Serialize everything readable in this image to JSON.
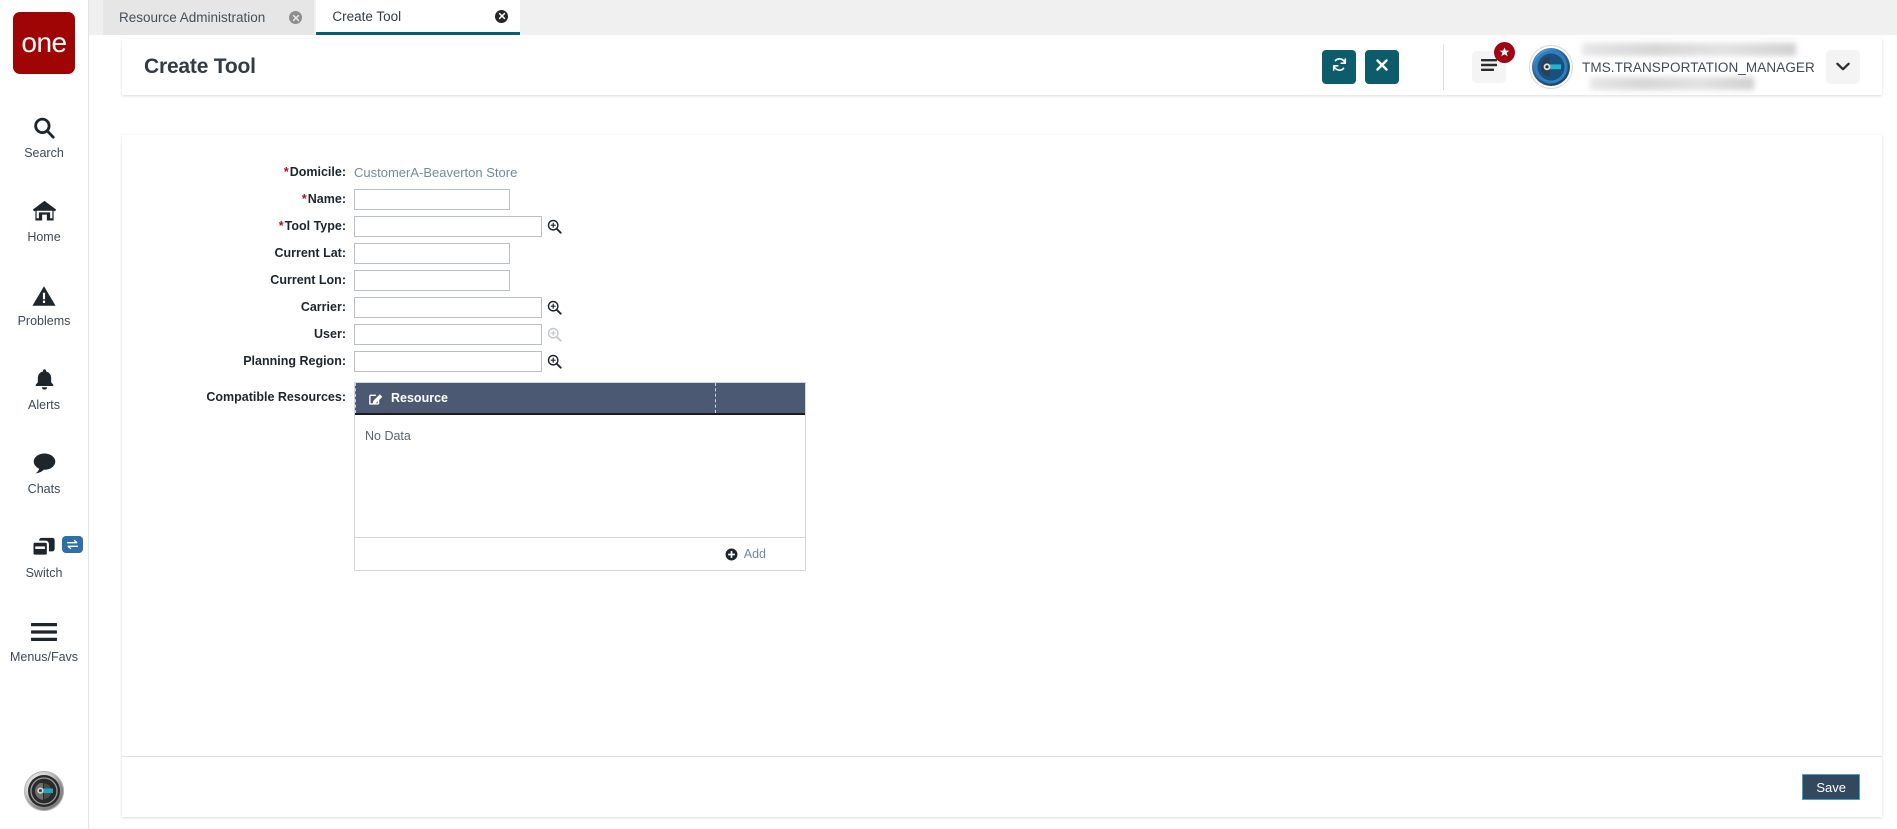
{
  "brand": {
    "logo_text": "one",
    "logo_color": "#a00505"
  },
  "sidebar": {
    "items": [
      {
        "label": "Search",
        "icon": "search-icon"
      },
      {
        "label": "Home",
        "icon": "home-icon"
      },
      {
        "label": "Problems",
        "icon": "warning-triangle-icon"
      },
      {
        "label": "Alerts",
        "icon": "bell-icon"
      },
      {
        "label": "Chats",
        "icon": "chat-bubble-icon"
      },
      {
        "label": "Switch",
        "icon": "windows-stack-icon",
        "badge_icon": "swap-arrows-icon"
      },
      {
        "label": "Menus/Favs",
        "icon": "hamburger-icon"
      }
    ],
    "bottom_avatar_icon": "ai-assistant-avatar"
  },
  "tabs": [
    {
      "label": "Resource Administration",
      "active": false,
      "close_icon": "close-circle-icon"
    },
    {
      "label": "Create Tool",
      "active": true,
      "close_icon": "close-circle-icon"
    }
  ],
  "header": {
    "title": "Create Tool",
    "refresh_icon": "refresh-icon",
    "close_icon": "close-x-icon",
    "menu_icon": "hamburger-menu-icon",
    "menu_badge_icon": "star-icon",
    "user_name": "TMS.TRANSPORTATION_MANAGER",
    "user_avatar_icon": "user-avatar",
    "caret_icon": "chevron-down-icon",
    "accent_color": "#0d5c6b",
    "badge_color": "#a00515"
  },
  "form": {
    "fields": [
      {
        "label": "Domicile",
        "required": true,
        "type": "link",
        "value": "CustomerA-Beaverton Store"
      },
      {
        "label": "Name",
        "required": true,
        "type": "text",
        "value": "",
        "width": "short"
      },
      {
        "label": "Tool Type",
        "required": true,
        "type": "lookup",
        "value": "",
        "width": "long",
        "lookup_enabled": true
      },
      {
        "label": "Current Lat",
        "required": false,
        "type": "text",
        "value": "",
        "width": "short"
      },
      {
        "label": "Current Lon",
        "required": false,
        "type": "text",
        "value": "",
        "width": "short"
      },
      {
        "label": "Carrier",
        "required": false,
        "type": "lookup",
        "value": "",
        "width": "long",
        "lookup_enabled": true
      },
      {
        "label": "User",
        "required": false,
        "type": "lookup",
        "value": "",
        "width": "long",
        "lookup_enabled": false
      },
      {
        "label": "Planning Region",
        "required": false,
        "type": "lookup",
        "value": "",
        "width": "long",
        "lookup_enabled": true
      }
    ],
    "resources_label": "Compatible Resources",
    "resources_required": false
  },
  "resources_table": {
    "edit_icon": "edit-pencil-icon",
    "columns": [
      "Resource",
      ""
    ],
    "rows": [],
    "empty_text": "No Data",
    "add_label": "Add",
    "add_icon": "plus-circle-icon",
    "header_color": "#4b5a72"
  },
  "footer": {
    "save_label": "Save",
    "save_bg": "#33485f",
    "save_border": "#3ba7c0"
  }
}
